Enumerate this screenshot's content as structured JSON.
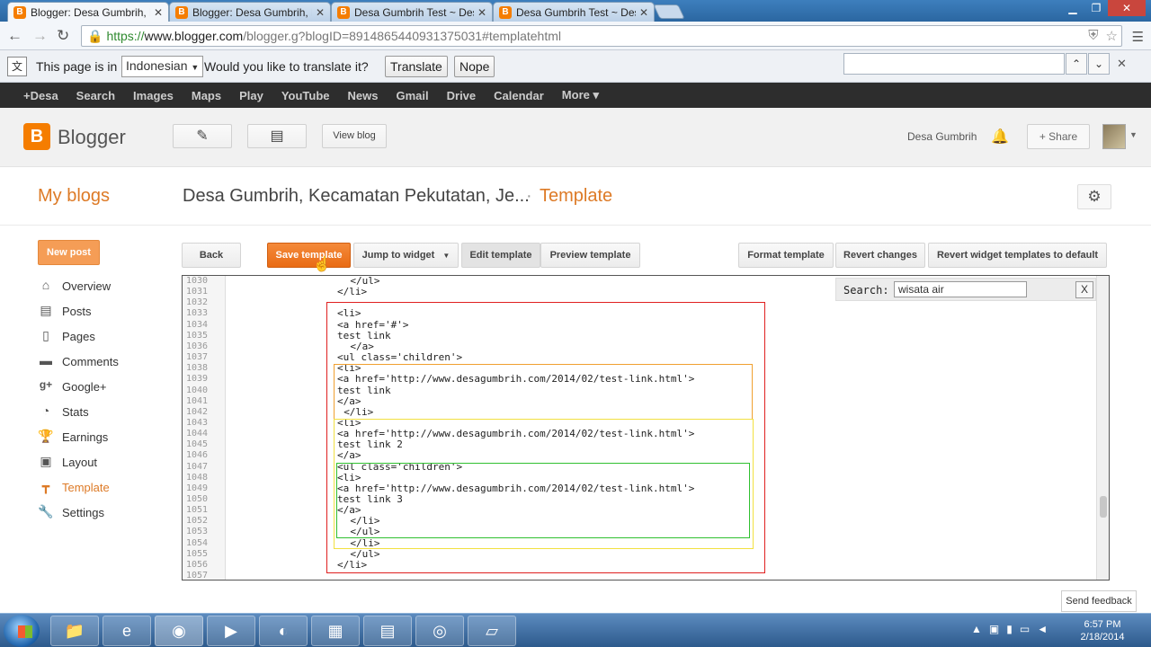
{
  "browser": {
    "tabs": [
      {
        "title": "Blogger: Desa Gumbrih, Kecamatan",
        "active": true
      },
      {
        "title": "Blogger: Desa Gumbrih, Kecamatan",
        "active": false
      },
      {
        "title": "Desa Gumbrih Test ~ Desa Gumbrih",
        "active": false
      },
      {
        "title": "Desa Gumbrih Test ~ Desa Gumbrih",
        "active": false
      }
    ],
    "url_scheme": "https://",
    "url_host": "www.blogger.com",
    "url_rest": "/blogger.g?blogID=8914865440931375031#templatehtml"
  },
  "translate_bar": {
    "prefix": "This page is in",
    "language": "Indonesian",
    "question": "Would you like to translate it?",
    "translate_label": "Translate",
    "nope_label": "Nope"
  },
  "google_bar": [
    "+Desa",
    "Search",
    "Images",
    "Maps",
    "Play",
    "YouTube",
    "News",
    "Gmail",
    "Drive",
    "Calendar",
    "More ▾"
  ],
  "header": {
    "logo": "Blogger",
    "view_blog": "View blog",
    "user": "Desa Gumbrih",
    "share": "+ Share"
  },
  "title_row": {
    "my_blogs": "My blogs",
    "blog_title": "Desa Gumbrih, Kecamatan Pekutatan, Je...",
    "separator": "·",
    "page": "Template"
  },
  "sidebar": {
    "new_post": "New post",
    "items": [
      {
        "label": "Overview",
        "icon": "home-icon",
        "active": false
      },
      {
        "label": "Posts",
        "icon": "posts-icon",
        "active": false
      },
      {
        "label": "Pages",
        "icon": "pages-icon",
        "active": false
      },
      {
        "label": "Comments",
        "icon": "comments-icon",
        "active": false
      },
      {
        "label": "Google+",
        "icon": "google-plus-icon",
        "active": false
      },
      {
        "label": "Stats",
        "icon": "stats-icon",
        "active": false
      },
      {
        "label": "Earnings",
        "icon": "trophy-icon",
        "active": false
      },
      {
        "label": "Layout",
        "icon": "layout-icon",
        "active": false
      },
      {
        "label": "Template",
        "icon": "template-icon",
        "active": true
      },
      {
        "label": "Settings",
        "icon": "wrench-icon",
        "active": false
      }
    ]
  },
  "editor_toolbar": {
    "back": "Back",
    "save": "Save template",
    "jump": "Jump to widget",
    "edit": "Edit template",
    "preview": "Preview template",
    "format": "Format template",
    "revert": "Revert changes",
    "revert_widgets": "Revert widget templates to default"
  },
  "editor": {
    "search_label": "Search:",
    "search_value": "wisata air",
    "search_close": "X",
    "lines": [
      {
        "n": "1030",
        "indent": 2,
        "text": "</ul>"
      },
      {
        "n": "1031",
        "indent": 0,
        "text": "</li>"
      },
      {
        "n": "1032",
        "indent": 0,
        "text": ""
      },
      {
        "n": "1033",
        "indent": 0,
        "text": "<li>"
      },
      {
        "n": "1034",
        "indent": 0,
        "text": "<a href='#'>"
      },
      {
        "n": "1035",
        "indent": 0,
        "text": "test link"
      },
      {
        "n": "1036",
        "indent": 2,
        "text": "</a>"
      },
      {
        "n": "1037",
        "indent": 0,
        "text": "<ul class='children'>"
      },
      {
        "n": "1038",
        "indent": 0,
        "text": "<li>"
      },
      {
        "n": "1039",
        "indent": 0,
        "text": "<a href='http://www.desagumbrih.com/2014/02/test-link.html'>"
      },
      {
        "n": "1040",
        "indent": 0,
        "text": "test link"
      },
      {
        "n": "1041",
        "indent": 0,
        "text": "</a>"
      },
      {
        "n": "1042",
        "indent": 1,
        "text": "</li>"
      },
      {
        "n": "1043",
        "indent": 0,
        "text": "<li>"
      },
      {
        "n": "1044",
        "indent": 0,
        "text": "<a href='http://www.desagumbrih.com/2014/02/test-link.html'>"
      },
      {
        "n": "1045",
        "indent": 0,
        "text": "test link 2"
      },
      {
        "n": "1046",
        "indent": 0,
        "text": "</a>"
      },
      {
        "n": "1047",
        "indent": 0,
        "text": "<ul class='children'>"
      },
      {
        "n": "1048",
        "indent": 0,
        "text": "<li>"
      },
      {
        "n": "1049",
        "indent": 0,
        "text": "<a href='http://www.desagumbrih.com/2014/02/test-link.html'>"
      },
      {
        "n": "1050",
        "indent": 0,
        "text": "test link 3"
      },
      {
        "n": "1051",
        "indent": 0,
        "text": "</a>"
      },
      {
        "n": "1052",
        "indent": 2,
        "text": "</li>"
      },
      {
        "n": "1053",
        "indent": 2,
        "text": "</ul>"
      },
      {
        "n": "1054",
        "indent": 2,
        "text": "</li>"
      },
      {
        "n": "1055",
        "indent": 2,
        "text": "</ul>"
      },
      {
        "n": "1056",
        "indent": 0,
        "text": "</li>"
      },
      {
        "n": "1057",
        "indent": 0,
        "text": ""
      }
    ]
  },
  "feedback": "Send feedback",
  "taskbar": {
    "time": "6:57 PM",
    "date": "2/18/2014"
  },
  "colors": {
    "accent": "#dd7a26",
    "save_button": "#e96b14",
    "box_red": "#e02020",
    "box_orange": "#f0a030",
    "box_yellow": "#f2e040",
    "box_green": "#30c030"
  }
}
